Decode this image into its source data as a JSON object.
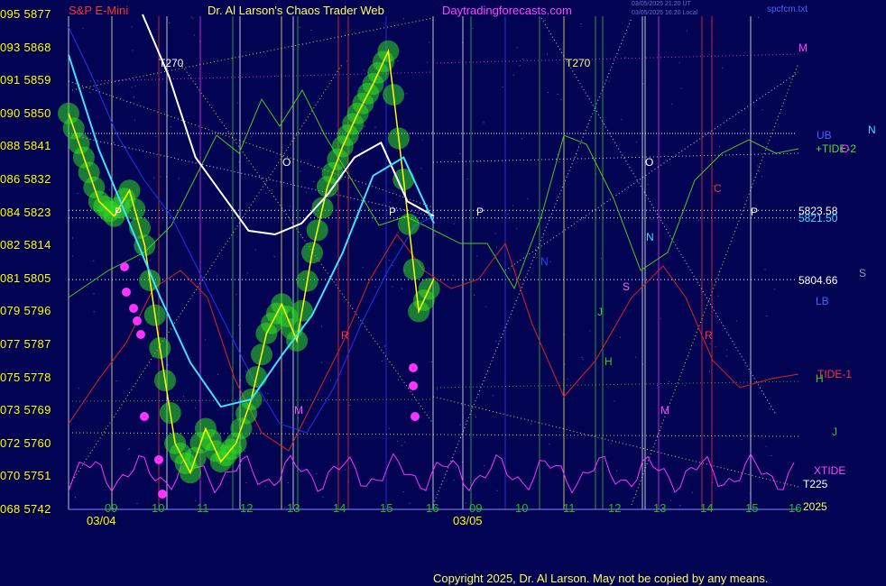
{
  "header": {
    "instrument": "S&P E-Mini",
    "title": "Dr. Al Larson's Chaos Trader Web",
    "site": "Daytradingforecasts.com",
    "stamp_1": "03/05/2025 21:20 UT",
    "stamp_2": "03/05/2025 16:20 Local",
    "file": "spcfcm.txt"
  },
  "copyright": "Copyright 2025, Dr. Al Larson. May not be copied by any means.",
  "y_axis": [
    {
      "code": "095",
      "price": "5877"
    },
    {
      "code": "093",
      "price": "5868"
    },
    {
      "code": "091",
      "price": "5859"
    },
    {
      "code": "090",
      "price": "5850"
    },
    {
      "code": "088",
      "price": "5841"
    },
    {
      "code": "086",
      "price": "5832"
    },
    {
      "code": "084",
      "price": "5823"
    },
    {
      "code": "082",
      "price": "5814"
    },
    {
      "code": "081",
      "price": "5805"
    },
    {
      "code": "079",
      "price": "5796"
    },
    {
      "code": "077",
      "price": "5787"
    },
    {
      "code": "075",
      "price": "5778"
    },
    {
      "code": "073",
      "price": "5769"
    },
    {
      "code": "072",
      "price": "5760"
    },
    {
      "code": "070",
      "price": "5751"
    },
    {
      "code": "068",
      "price": "5742"
    }
  ],
  "x_axis": {
    "hours": [
      "09",
      "10",
      "11",
      "12",
      "13",
      "14",
      "15",
      "16",
      "09",
      "10",
      "11",
      "12",
      "13",
      "14",
      "15",
      "16"
    ],
    "dates": [
      "03/04",
      "03/05"
    ]
  },
  "right_labels": {
    "m": "M",
    "ub": "UB",
    "tide2": "+TIDE-2",
    "level_1": "5823.58",
    "level_2": "5821.50",
    "level_3": "5804.66",
    "lb": "LB",
    "tide1": "TIDE-1",
    "h": "H",
    "j": "J",
    "xtide": "XTIDE",
    "t225": "T225",
    "year": "2025",
    "n": "N",
    "s": "S",
    "o": "O"
  },
  "chart_labels": {
    "t270_a": "T270",
    "t270_b": "T270",
    "o_a": "O",
    "o_b": "O",
    "p_a": "P",
    "p_b": "P",
    "p_c": "P",
    "p_d": "P",
    "r_a": "R",
    "r_b": "R",
    "r_c": "R",
    "m_a": "M",
    "m_b": "M",
    "n_a": "N",
    "n_b": "N",
    "s_a": "S",
    "h_a": "H",
    "j_a": "J",
    "c_a": "C"
  },
  "colors": {
    "background": "#020352",
    "price_white": "#ffffff",
    "cyan": "#40e0ff",
    "yellow": "#ffff00",
    "green_glow": "#33dd22",
    "magenta": "#ff33ff",
    "tide_green": "#44cc22",
    "red": "#dd2222",
    "blue": "#2233ee"
  },
  "chart_data": {
    "type": "line",
    "title": "S&P E-Mini",
    "ylim": [
      5742,
      5877
    ],
    "y_ticks": [
      5877,
      5868,
      5859,
      5850,
      5841,
      5832,
      5823,
      5814,
      5805,
      5796,
      5787,
      5778,
      5769,
      5760,
      5751,
      5742
    ],
    "price_levels": [
      5823.58,
      5821.5,
      5804.66
    ],
    "x_categories": [
      "03/04 09",
      "10",
      "11",
      "12",
      "13",
      "14",
      "15",
      "16",
      "03/05 09",
      "10",
      "11",
      "12",
      "13",
      "14",
      "15",
      "16"
    ],
    "series": [
      {
        "name": "",
        "description_color": "yellow",
        "values": [
          5850,
          5838,
          5826,
          5822,
          5829,
          5814,
          5786,
          5760,
          5752,
          5764,
          5755,
          5760,
          5772,
          5790,
          5798,
          5788,
          5812,
          5830,
          5841,
          5850,
          5858,
          5867,
          5832,
          5796,
          5805
        ]
      },
      {
        "name": "",
        "description_color": "white",
        "values": [
          5877,
          5860,
          5838,
          5828,
          5818,
          5817,
          5820,
          5828,
          5838,
          5842,
          5826,
          5822
        ]
      },
      {
        "name": "",
        "description_color": "cyan",
        "values": [
          5866,
          5840,
          5820,
          5800,
          5782,
          5770,
          5772,
          5784,
          5795,
          5812,
          5833,
          5838,
          5820
        ]
      }
    ]
  }
}
